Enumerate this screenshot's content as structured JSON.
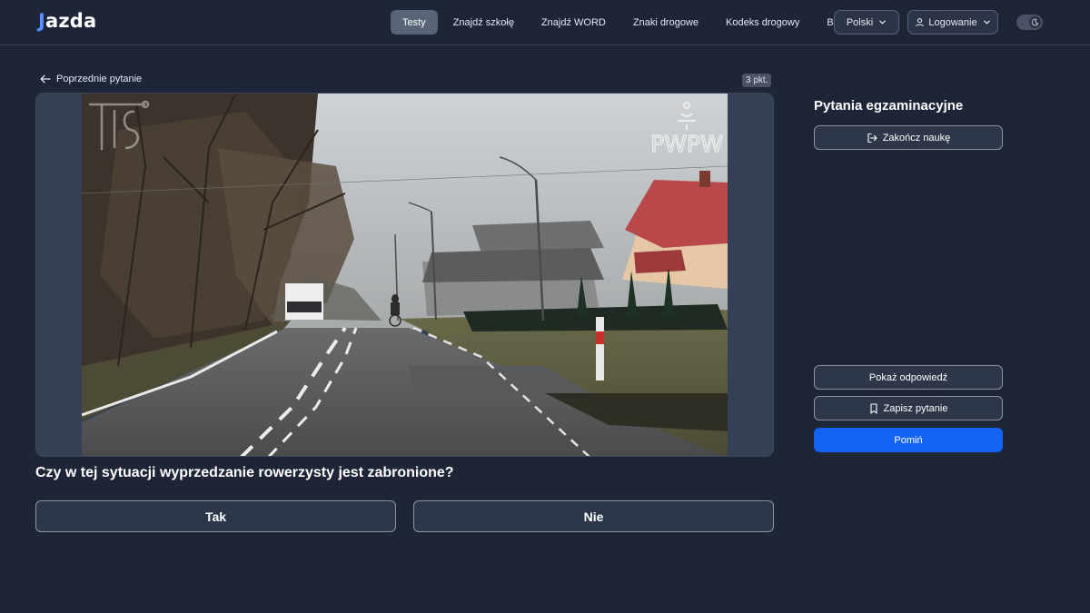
{
  "header": {
    "logo_initial": "J",
    "logo_rest": "azda",
    "nav": [
      {
        "label": "Testy",
        "active": true
      },
      {
        "label": "Znajdź szkołę"
      },
      {
        "label": "Znajdź WORD"
      },
      {
        "label": "Znaki drogowe"
      },
      {
        "label": "Kodeks drogowy"
      },
      {
        "label": "Blog"
      }
    ],
    "language_label": "Polski",
    "login_label": "Logowanie",
    "icons": {
      "dropdown": "chevron-down-icon",
      "user": "user-icon",
      "theme": "moon-icon"
    }
  },
  "main": {
    "prev_question_label": "Poprzednie pytanie",
    "points_label": "3 pkt.",
    "media_watermark": "PWPW",
    "question_text": "Czy w tej sytuacji wyprzedzanie rowerzysty jest zabronione?",
    "answers": [
      "Tak",
      "Nie"
    ]
  },
  "sidebar": {
    "title": "Pytania egzaminacyjne",
    "end_label": "Zakończ naukę",
    "show_answer_label": "Pokaż odpowiedź",
    "save_label": "Zapisz pytanie",
    "skip_label": "Pomiń"
  },
  "colors": {
    "background": "#1e2537",
    "primary": "#1463f3",
    "logo_accent": "#5b8cff"
  }
}
